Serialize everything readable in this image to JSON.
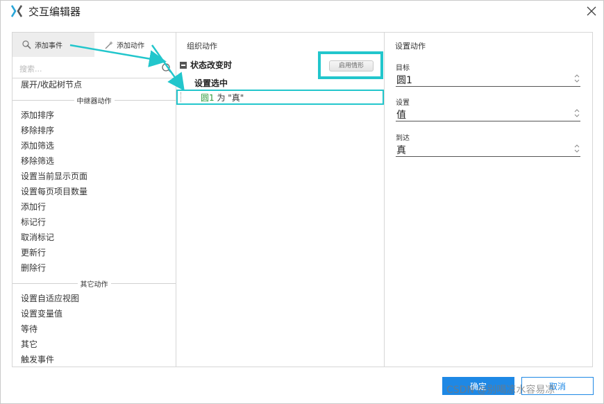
{
  "window": {
    "title": "交互编辑器",
    "accent_color": "#1e88e5",
    "highlight_color": "#22c6cc"
  },
  "left_panel": {
    "tabs": [
      {
        "label": "添加事件",
        "icon": "event-icon"
      },
      {
        "label": "添加动作",
        "icon": "action-sparkle-icon"
      }
    ],
    "search_placeholder": "搜索...",
    "top_item": "展开/收起树节点",
    "groups": [
      {
        "header": "中继器动作",
        "items": [
          "添加排序",
          "移除排序",
          "添加筛选",
          "移除筛选",
          "设置当前显示页面",
          "设置每页项目数量",
          "添加行",
          "标记行",
          "取消标记",
          "更新行",
          "删除行"
        ]
      },
      {
        "header": "其它动作",
        "items": [
          "设置自适应视图",
          "设置变量值",
          "等待",
          "其它",
          "触发事件"
        ]
      }
    ]
  },
  "middle_panel": {
    "title": "组织动作",
    "case_label": "状态改变时",
    "enable_case_button": "启用情形",
    "action_label": "设置选中",
    "action_detail": {
      "target": "圆1",
      "text": " 为 \"真\""
    }
  },
  "right_panel": {
    "title": "设置动作",
    "fields": [
      {
        "label": "目标",
        "value": "圆1"
      },
      {
        "label": "设置",
        "value": "值"
      },
      {
        "label": "到达",
        "value": "真"
      }
    ]
  },
  "footer": {
    "ok_label": "确定",
    "cancel_label": "取消",
    "watermark": "CSDN @别喝凉水容易凉"
  }
}
